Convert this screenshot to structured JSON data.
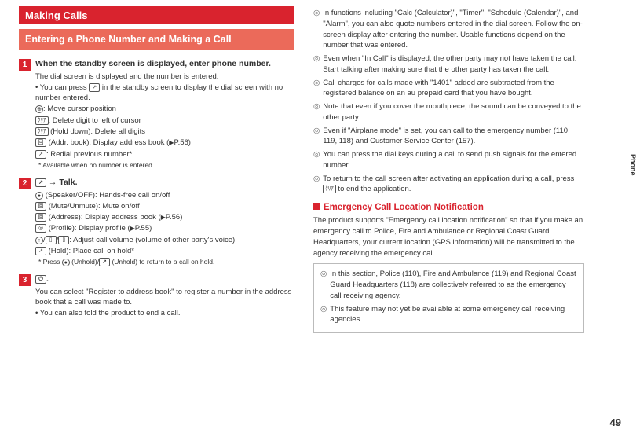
{
  "sideTab": "Phone",
  "pageNumber": "49",
  "left": {
    "h1": "Making Calls",
    "h2": "Entering a Phone Number and Making a Call",
    "step1": {
      "num": "1",
      "title": "When the standby screen is displayed, enter phone number.",
      "l1": "The dial screen is displayed and the number is entered.",
      "l2a": "• You can press ",
      "l2b": " in the standby screen to display the dial screen with no number entered.",
      "l3": ": Move cursor position",
      "l4": ": Delete digit to left of cursor",
      "l5": " (Hold down): Delete all digits",
      "l6a": " (Addr. book): Display address book (",
      "l6b": "P.56)",
      "l7": ": Redial previous number*",
      "l8": "* Available when no number is entered."
    },
    "step2": {
      "num": "2",
      "titleA": " → Talk.",
      "l1": " (Speaker/OFF): Hands-free call on/off",
      "l2": " (Mute/Unmute): Mute on/off",
      "l3a": " (Address): Display address book (",
      "l3b": "P.56)",
      "l4a": " (Profile): Display profile (",
      "l4b": "P.55)",
      "l5": ": Adjust call volume (volume of other party's voice)",
      "l6": " (Hold): Place call on hold*",
      "l7a": "* Press ",
      "l7b": " (Unhold)/",
      "l7c": " (Unhold) to return to a call on hold."
    },
    "step3": {
      "num": "3",
      "titleSuffix": ".",
      "l1": "You can select \"Register to address book\" to register a number in the address book that a call was made to.",
      "l2": "• You can also fold the product to end a call."
    }
  },
  "right": {
    "b1": "In functions including \"Calc (Calculator)\", \"Timer\", \"Schedule (Calendar)\", and \"Alarm\", you can also quote numbers entered in the dial screen. Follow the on-screen display after entering the number. Usable functions depend on the number that was entered.",
    "b2": "Even when \"In Call\" is displayed, the other party may not have taken the call. Start talking after making sure that the other party has taken the call.",
    "b3": "Call charges for calls made with \"1401\" added are subtracted from the registered balance on an au prepaid card that you have bought.",
    "b4": "Note that even if you cover the mouthpiece, the sound can be conveyed to the other party.",
    "b5": "Even if \"Airplane mode\" is set, you can call to the emergency number (110, 119, 118) and Customer Service Center (157).",
    "b6": "You can press the dial keys during a call to send push signals for the entered number.",
    "b7a": "To return to the call screen after activating an application during a call, press ",
    "b7b": " to end the application.",
    "h3": "Emergency Call Location Notification",
    "p1": "The product supports \"Emergency call location notification\" so that if you make an emergency call to Police, Fire and Ambulance or Regional Coast Guard Headquarters, your current location (GPS information) will be transmitted to the agency receiving the emergency call.",
    "box1": "In this section, Police (110), Fire and Ambulance (119) and Regional Coast Guard Headquarters (118) are collectively referred to as the emergency call receiving agency.",
    "box2": "This feature may not yet be available at some emergency call receiving agencies."
  }
}
